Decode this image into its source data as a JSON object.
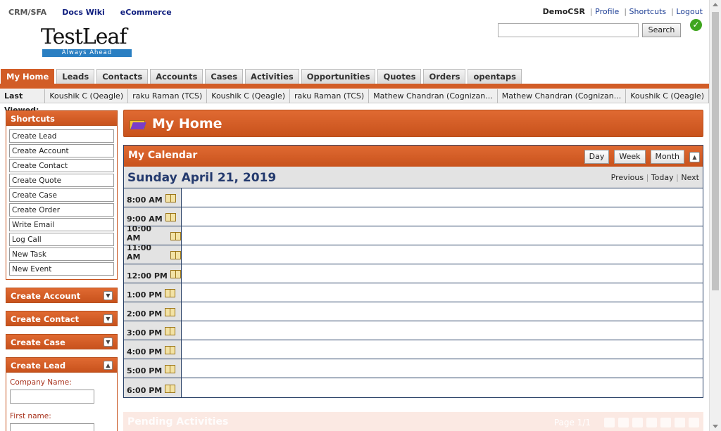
{
  "topnav": [
    "CRM/SFA",
    "Docs Wiki",
    "eCommerce"
  ],
  "logo": {
    "brand": "TestLeaf",
    "tagline": "Always Ahead"
  },
  "user": {
    "name": "DemoCSR",
    "profile": "Profile",
    "shortcuts": "Shortcuts",
    "logout": "Logout"
  },
  "search": {
    "value": "",
    "button": "Search"
  },
  "tabs": [
    "My Home",
    "Leads",
    "Contacts",
    "Accounts",
    "Cases",
    "Activities",
    "Opportunities",
    "Quotes",
    "Orders",
    "opentaps"
  ],
  "last_viewed": {
    "label": "Last Viewed:",
    "items": [
      "Koushik C (Qeagle)",
      "raku Raman (TCS)",
      "Koushik C (Qeagle)",
      "raku Raman (TCS)",
      "Mathew Chandran (Cognizan...",
      "Mathew Chandran (Cognizan...",
      "Koushik C (Qeagle)"
    ]
  },
  "sidebar": {
    "shortcuts_title": "Shortcuts",
    "shortcuts": [
      "Create Lead",
      "Create Account",
      "Create Contact",
      "Create Quote",
      "Create Case",
      "Create Order",
      "Write Email",
      "Log Call",
      "New Task",
      "New Event"
    ],
    "panels": [
      "Create Account",
      "Create Contact",
      "Create Case"
    ],
    "create_lead": {
      "title": "Create Lead",
      "company_label": "Company Name:",
      "first_name_label": "First name:"
    }
  },
  "main": {
    "title": "My Home",
    "calendar": {
      "title": "My Calendar",
      "views": [
        "Day",
        "Week",
        "Month"
      ],
      "date": "Sunday April 21, 2019",
      "nav": {
        "previous": "Previous",
        "today": "Today",
        "next": "Next"
      },
      "hours": [
        "8:00 AM",
        "9:00 AM",
        "10:00 AM",
        "11:00 AM",
        "12:00 PM",
        "1:00 PM",
        "2:00 PM",
        "3:00 PM",
        "4:00 PM",
        "5:00 PM",
        "6:00 PM"
      ]
    },
    "pending": {
      "title": "Pending Activities",
      "page": "Page 1/1"
    }
  },
  "colors": {
    "accent": "#d25d27",
    "navy": "#243a6e",
    "link": "#1d3e95"
  }
}
